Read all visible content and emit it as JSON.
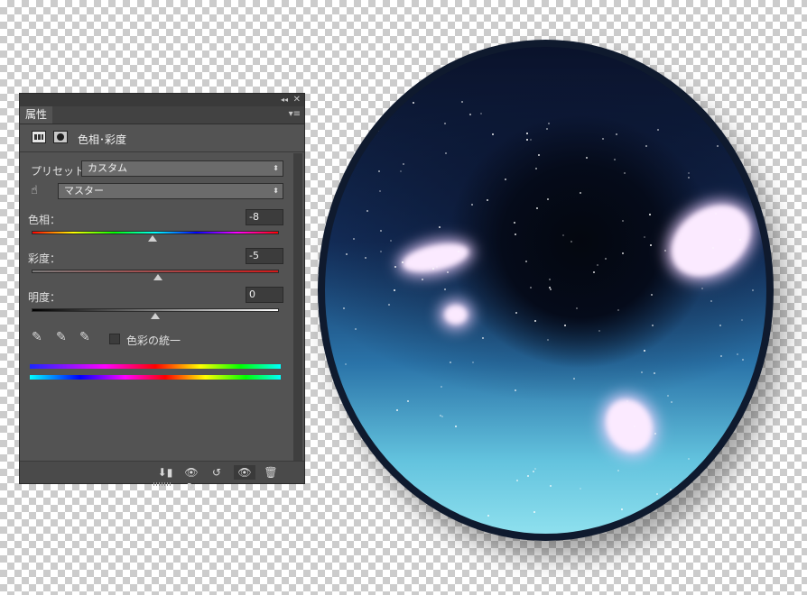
{
  "panel": {
    "collapse_glyph": "◂◂",
    "close_glyph": "✕",
    "tab_label": "属性",
    "tab_menu_glyph": "▾≡",
    "header_title": "色相･彩度",
    "preset_label": "プリセット：",
    "preset_value": "カスタム",
    "channel_value": "マスター",
    "hue": {
      "label": "色相：",
      "value": "-8",
      "level": 0.49
    },
    "saturation": {
      "label": "彩度：",
      "value": "-5",
      "level": 0.51
    },
    "lightness": {
      "label": "明度：",
      "value": "0",
      "level": 0.5
    },
    "colorize_label": "色彩の統一",
    "colorize_checked": false,
    "arrow_glyph": "⬍",
    "hand_icon_glyph": "☝",
    "eyedropper_glyph": "✎",
    "bottom_icons": [
      {
        "name": "clip-to-layer-icon",
        "glyph": "⬇▮"
      },
      {
        "name": "view-previous-state-icon",
        "glyph": "👁↻"
      },
      {
        "name": "reset-icon",
        "glyph": "↺"
      },
      {
        "name": "visibility-icon",
        "glyph": "👁"
      },
      {
        "name": "delete-icon",
        "glyph": "🗑"
      }
    ]
  },
  "colors": {
    "panel_bg": "#535353",
    "hue_gradient": [
      "#ff0000",
      "#ffff00",
      "#00ff00",
      "#00ffff",
      "#0000ff",
      "#ff00ff",
      "#ff0000"
    ],
    "saturation_gradient": [
      "#7a7a7a",
      "#d11a1a"
    ],
    "lightness_gradient": [
      "#000000",
      "#7f7f7f",
      "#ffffff"
    ],
    "top_color_bar": [
      "#1a27ff",
      "#ff00ff",
      "#ff0000",
      "#ffff00",
      "#00ff00",
      "#00ffff"
    ],
    "bottom_color_bar": [
      "#00ffff",
      "#0000ff",
      "#ff00ff",
      "#ff0000",
      "#ffff00",
      "#00ff00",
      "#00ffff"
    ]
  }
}
